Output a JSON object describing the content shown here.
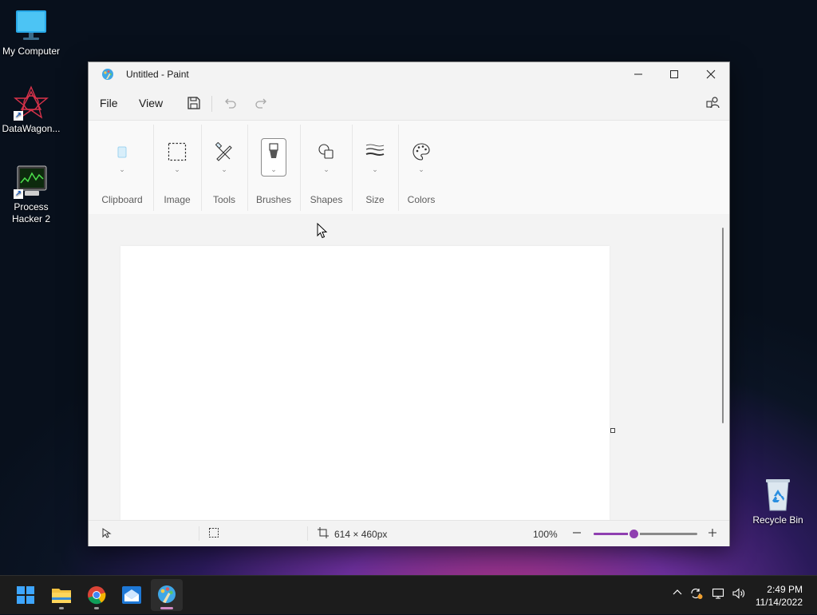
{
  "desktop": {
    "icons": [
      {
        "label": "My Computer"
      },
      {
        "label": "DataWagon..."
      },
      {
        "label": "Process Hacker 2"
      },
      {
        "label": "Recycle Bin"
      }
    ]
  },
  "window": {
    "title": "Untitled - Paint",
    "menu": {
      "file": "File",
      "view": "View"
    },
    "ribbon": {
      "groups": [
        {
          "label": "Clipboard",
          "icon": "clipboard-icon"
        },
        {
          "label": "Image",
          "icon": "selection-icon"
        },
        {
          "label": "Tools",
          "icon": "tools-icon"
        },
        {
          "label": "Brushes",
          "icon": "brush-icon"
        },
        {
          "label": "Shapes",
          "icon": "shapes-icon"
        },
        {
          "label": "Size",
          "icon": "stroke-size-icon"
        },
        {
          "label": "Colors",
          "icon": "palette-icon"
        }
      ]
    },
    "status": {
      "canvas_size": "614 × 460px",
      "zoom": "100%",
      "zoom_fraction": 0.385
    },
    "colors": {
      "accent": "#8f3fb0",
      "window_bg": "#f3f3f3",
      "canvas": "#ffffff"
    }
  },
  "taskbar": {
    "apps": [
      "start-icon",
      "file-explorer-icon",
      "chrome-icon",
      "mail-icon",
      "paint-icon"
    ],
    "active_app": "paint-icon",
    "time": "2:49 PM",
    "date": "11/14/2022"
  }
}
